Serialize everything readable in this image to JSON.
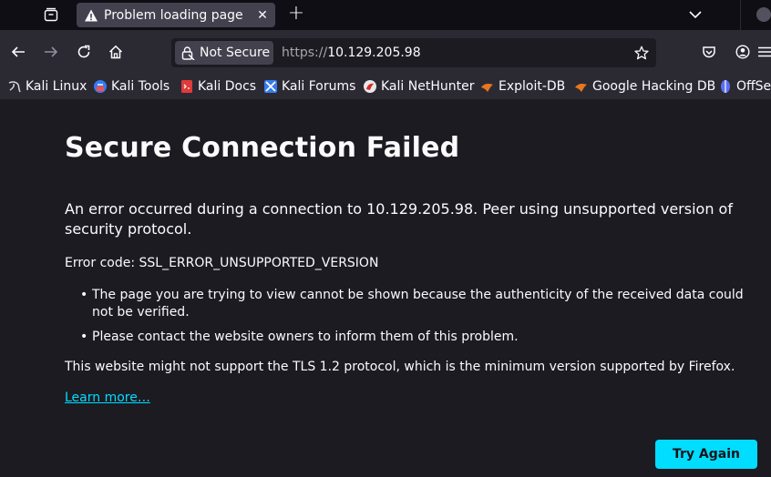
{
  "tab": {
    "title": "Problem loading page",
    "close_glyph": "✕",
    "new_tab_glyph": "+"
  },
  "nav": {
    "site_info_label": "Not Secure",
    "url_scheme": "https://",
    "url_host": "10.129.205.98"
  },
  "bookmarks": [
    {
      "label": "Kali Linux",
      "icon": "kali-dragon-icon"
    },
    {
      "label": "Kali Tools",
      "icon": "kali-tools-icon"
    },
    {
      "label": "Kali Docs",
      "icon": "kali-docs-icon"
    },
    {
      "label": "Kali Forums",
      "icon": "kali-forums-icon"
    },
    {
      "label": "Kali NetHunter",
      "icon": "kali-nethunter-icon"
    },
    {
      "label": "Exploit-DB",
      "icon": "exploit-db-icon"
    },
    {
      "label": "Google Hacking DB",
      "icon": "ghdb-icon"
    },
    {
      "label": "OffSe",
      "icon": "offsec-icon"
    }
  ],
  "error": {
    "title": "Secure Connection Failed",
    "description": "An error occurred during a connection to 10.129.205.98. Peer using unsupported version of security protocol.",
    "code_line": "Error code: SSL_ERROR_UNSUPPORTED_VERSION",
    "bullets": [
      "The page you are trying to view cannot be shown because the authenticity of the received data could not be verified.",
      "Please contact the website owners to inform them of this problem."
    ],
    "tls_note": "This website might not support the TLS 1.2 protocol, which is the minimum version supported by Firefox.",
    "learn_more": "Learn more…",
    "try_again": "Try Again"
  },
  "colors": {
    "accent": "#00ddff",
    "page_bg": "#1c1b22",
    "toolbar_bg": "#2b2a33",
    "tabstrip_bg": "#0f0e14",
    "selected_tab_bg": "#42414d"
  }
}
